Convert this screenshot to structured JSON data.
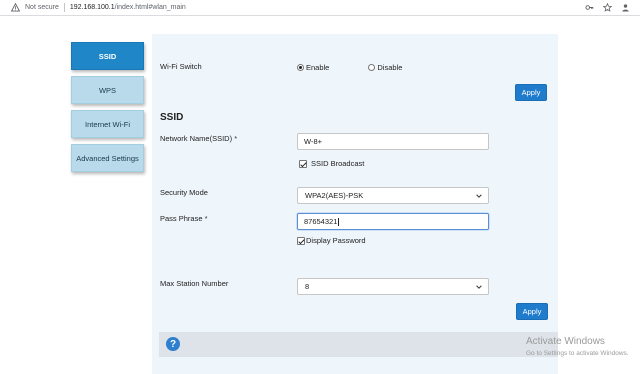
{
  "browser": {
    "security_label": "Not secure",
    "url_host": "192.168.100.1",
    "url_path": "/index.html#wlan_main"
  },
  "nav": {
    "items": [
      {
        "label": "SSID",
        "active": true
      },
      {
        "label": "WPS",
        "active": false
      },
      {
        "label": "Internet Wi-Fi",
        "active": false
      },
      {
        "label": "Advanced Settings",
        "active": false
      }
    ]
  },
  "wifi_switch": {
    "label": "Wi-Fi Switch",
    "options": [
      "Enable",
      "Disable"
    ],
    "selected": "Enable"
  },
  "apply_label": "Apply",
  "section_title": "SSID",
  "network_name": {
    "label": "Network Name(SSID)",
    "required_mark": "*",
    "value": "W-8+"
  },
  "ssid_broadcast": {
    "label": "SSID Broadcast",
    "checked": true
  },
  "security_mode": {
    "label": "Security Mode",
    "value": "WPA2(AES)-PSK"
  },
  "pass_phrase": {
    "label": "Pass Phrase",
    "required_mark": "*",
    "value": "87654321"
  },
  "display_password": {
    "label": "Display Password",
    "checked": true
  },
  "max_station": {
    "label": "Max Station Number",
    "value": "8"
  },
  "help_icon": "question-mark-icon",
  "watermark": {
    "title": "Activate Windows",
    "subtitle": "Go to Settings to activate Windows."
  },
  "colors": {
    "accent": "#1f86c8",
    "nav_inactive": "#b8daea",
    "apply_button": "#1f7bcc",
    "panel_bg": "#eef5fb",
    "help_bar": "#dde3e8"
  }
}
